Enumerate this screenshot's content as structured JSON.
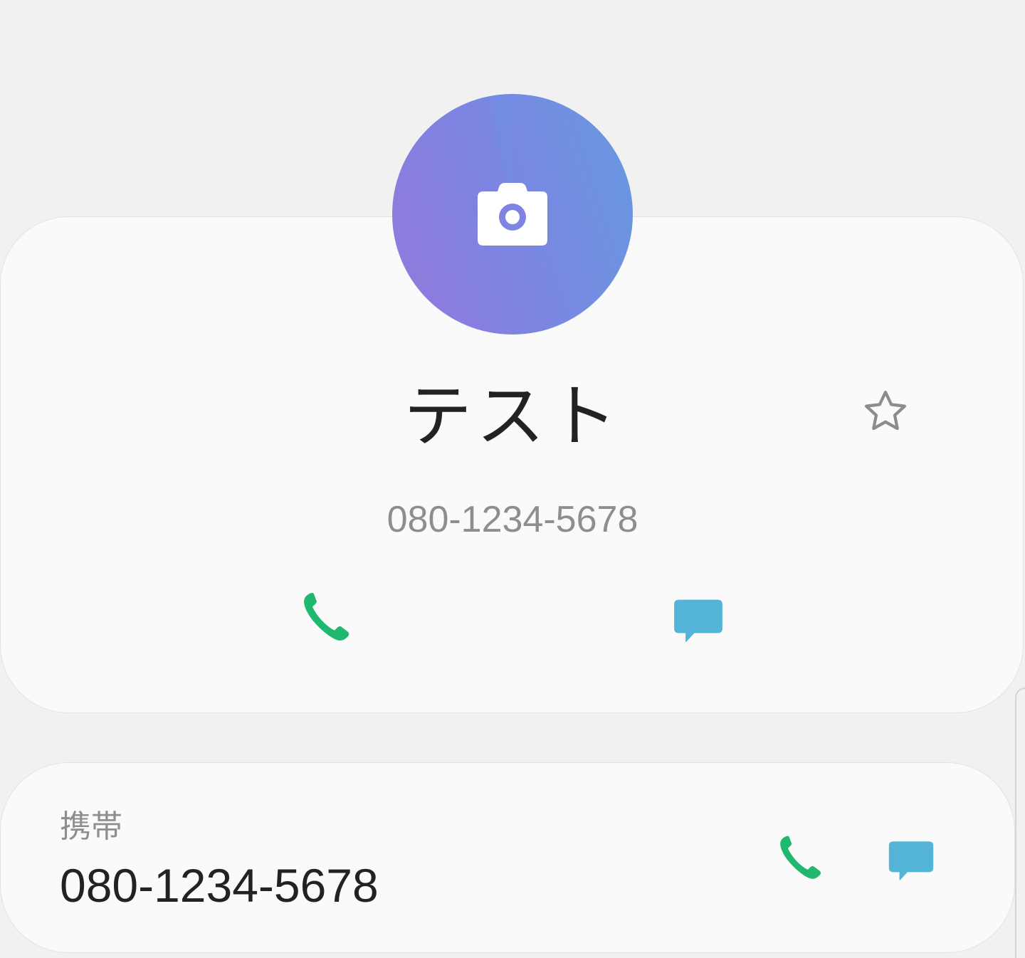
{
  "contact": {
    "name": "テスト",
    "primary_number": "080-1234-5678",
    "avatar_icon": "camera-icon",
    "avatar_colors": [
      "#9378dc",
      "#6699e0"
    ],
    "favorite_icon": "star-outline-icon"
  },
  "actions": {
    "call_icon": "phone-icon",
    "message_icon": "message-icon",
    "call_color": "#1fb86e",
    "message_color": "#54b4d8"
  },
  "numbers": [
    {
      "label": "携帯",
      "value": "080-1234-5678"
    }
  ]
}
